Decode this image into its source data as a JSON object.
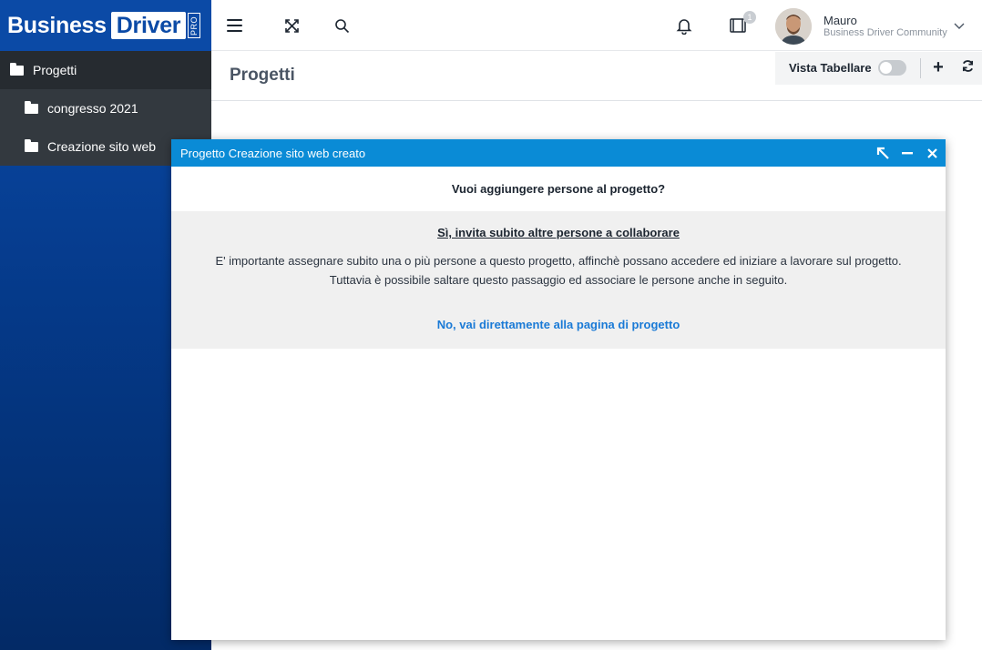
{
  "brand": {
    "word1": "Business",
    "word2": "Driver",
    "badge": "PRO"
  },
  "sidebar": {
    "root": {
      "label": "Progetti",
      "icon": "folder-icon"
    },
    "items": [
      {
        "label": "congresso 2021",
        "icon": "folder-icon"
      },
      {
        "label": "Creazione sito web",
        "icon": "folder-icon"
      }
    ]
  },
  "topbar": {
    "icons": [
      "menu-icon",
      "fullscreen-icon",
      "search-icon",
      "bell-icon",
      "tablet-icon"
    ],
    "notification_count": "1",
    "user": {
      "name": "Mauro",
      "community": "Business Driver Community"
    }
  },
  "page": {
    "title": "Progetti",
    "toolbar": {
      "vista_label": "Vista Tabellare",
      "vista_enabled": false,
      "add_label": "+"
    }
  },
  "dialog": {
    "title": "Progetto Creazione sito web creato",
    "question": "Vuoi aggiungere persone al progetto?",
    "invite_link": "Sì, invita subito altre persone a collaborare",
    "explain_line1": "E' importante assegnare subito una o più persone a questo progetto, affinchè possano accedere ed iniziare a lavorare sul progetto.",
    "explain_line2": "Tuttavia è possibile saltare questo passaggio ed associare le persone anche in seguito.",
    "skip_link": "No, vai direttamente alla pagina di progetto"
  },
  "colors": {
    "sidebar_blue": "#0b4aa6",
    "dialog_header": "#0a8bd6",
    "link_blue": "#1a7ad6"
  }
}
